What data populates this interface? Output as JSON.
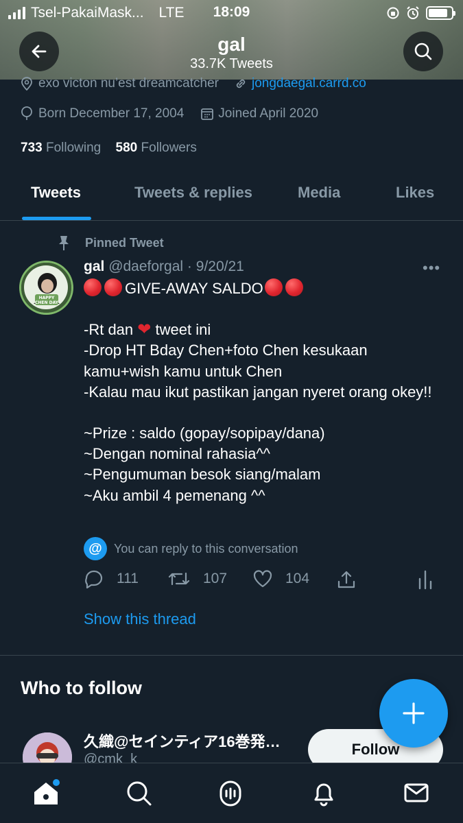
{
  "status_bar": {
    "carrier": "Tsel-PakaiMask...",
    "network": "LTE",
    "time": "18:09"
  },
  "header": {
    "name": "gal",
    "tweet_count": "33.7K Tweets"
  },
  "profile": {
    "bio_tags": "exo victon nu’est dreamcatcher",
    "link": "jongdaegal.carrd.co",
    "born": "Born December 17, 2004",
    "joined": "Joined April 2020",
    "following_count": "733",
    "following_label": "Following",
    "followers_count": "580",
    "followers_label": "Followers"
  },
  "tabs": [
    {
      "label": "Tweets",
      "active": true
    },
    {
      "label": "Tweets & replies"
    },
    {
      "label": "Media"
    },
    {
      "label": "Likes"
    }
  ],
  "pinned_tweet": {
    "pinned_label": "Pinned Tweet",
    "author_name": "gal",
    "author_handle": "@daeforgal",
    "date": "9/20/21",
    "more_label": "•••",
    "headline": "GIVE-AWAY SALDO",
    "lines": [
      "-Rt dan",
      "tweet ini",
      "-Drop HT Bday Chen+foto Chen kesukaan kamu+wish kamu untuk Chen",
      "-Kalau mau ikut pastikan jangan nyeret orang okey!!",
      "~Prize : saldo (gopay/sopipay/dana)",
      "~Dengan nominal rahasia^^",
      "~Pengumuman besok siang/malam",
      "~Aku ambil 4 pemenang ^^"
    ],
    "reply_note": "You can reply to this conversation",
    "reply_count": "111",
    "retweet_count": "107",
    "like_count": "104",
    "show_thread": "Show this thread",
    "avatar_text_top": "HAPPY",
    "avatar_text_bottom": "CHEN DAY"
  },
  "who_to_follow": {
    "title": "Who to follow",
    "suggestion": {
      "name": "久織@セインティア16巻発…",
      "handle": "@cmk_k",
      "follow_label": "Follow"
    }
  },
  "colors": {
    "background": "#15202b",
    "accent": "#1d9bf0",
    "muted": "#8899a6",
    "divider": "#38444d"
  },
  "icons": [
    "back-arrow-icon",
    "search-icon",
    "location-icon",
    "link-icon",
    "balloon-icon",
    "calendar-icon",
    "pin-icon",
    "at-icon",
    "reply-icon",
    "retweet-icon",
    "like-icon",
    "share-icon",
    "analytics-icon",
    "compose-plus-icon",
    "home-icon",
    "spaces-icon",
    "notifications-icon",
    "messages-icon"
  ]
}
